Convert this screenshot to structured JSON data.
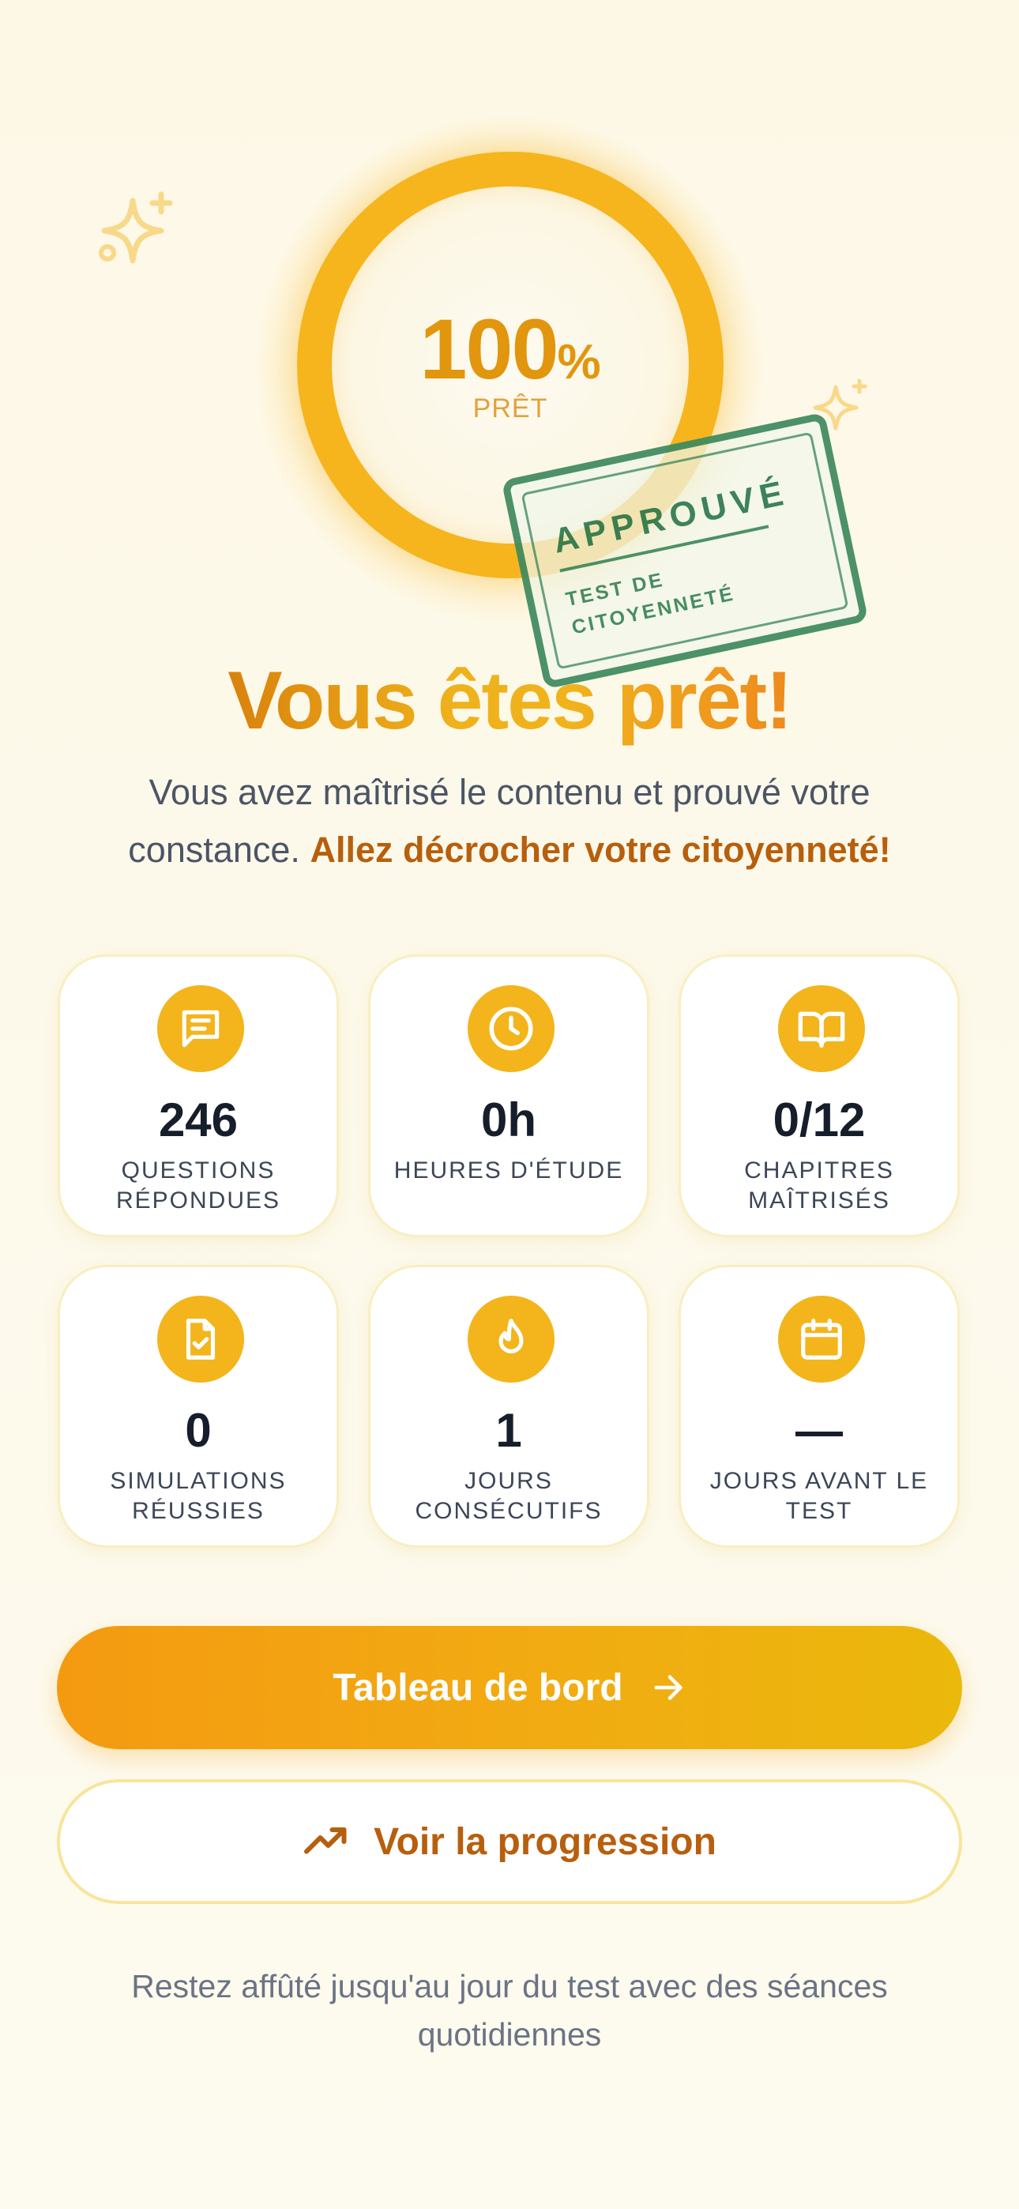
{
  "readiness": {
    "percent_value": "100",
    "percent_unit": "%",
    "label": "PRÊT",
    "progress_fraction": 1.0
  },
  "stamp": {
    "title": "APPROUVÉ",
    "subtitle_line1": "TEST DE",
    "subtitle_line2": "CITOYENNETÉ"
  },
  "headline": "Vous êtes prêt!",
  "subtext": {
    "plain": "Vous avez maîtrisé le contenu et prouvé votre constance. ",
    "highlight": "Allez décrocher votre citoyenneté!"
  },
  "stats": [
    {
      "icon": "message-icon",
      "value": "246",
      "label": "QUESTIONS RÉPONDUES"
    },
    {
      "icon": "clock-icon",
      "value": "0h",
      "label": "HEURES D'ÉTUDE"
    },
    {
      "icon": "book-icon",
      "value": "0/12",
      "label": "CHAPITRES MAÎTRISÉS"
    },
    {
      "icon": "file-check-icon",
      "value": "0",
      "label": "SIMULATIONS RÉUSSIES"
    },
    {
      "icon": "flame-icon",
      "value": "1",
      "label": "JOURS CONSÉCUTIFS"
    },
    {
      "icon": "calendar-icon",
      "value": "—",
      "label": "JOURS AVANT LE TEST"
    }
  ],
  "buttons": {
    "dashboard_label": "Tableau de bord",
    "progress_label": "Voir la progression"
  },
  "footer_note": "Restez affûté jusqu'au jour du test avec des séances quotidiennes",
  "colors": {
    "accent": "#f3b51b",
    "accent_dark": "#b75f0d",
    "stamp_green": "#3f8a5f",
    "text_dark": "#161d2b"
  }
}
